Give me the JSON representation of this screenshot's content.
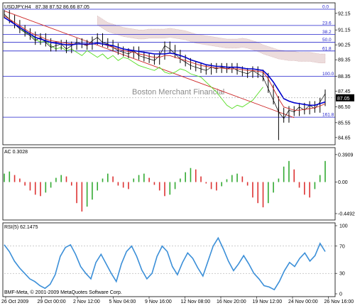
{
  "chart_data": {
    "type": "line",
    "main": {
      "title": "USDJPY,H4",
      "ohlc": "87.38 87.52 86.66 87.05",
      "watermark": "Boston Merchant Financial",
      "ylim": [
        84.3,
        92.7
      ],
      "y_ticks": [
        "92.15",
        "91.15",
        "90.25",
        "89.35",
        "88.35",
        "87.45",
        "86.50",
        "85.55",
        "84.65"
      ],
      "current_price": "87.05",
      "fibo_levels": [
        {
          "label": "0.0",
          "value": 92.4
        },
        {
          "label": "23.6",
          "value": 91.42
        },
        {
          "label": "38.2",
          "value": 90.88
        },
        {
          "label": "50.0",
          "value": 90.4
        },
        {
          "label": "61.8",
          "value": 89.88
        },
        {
          "label": "100.0",
          "value": 88.35
        },
        {
          "label": "161.8",
          "value": 85.88
        }
      ],
      "price_close": [
        92.1,
        91.8,
        91.5,
        91.2,
        91.0,
        90.8,
        90.5,
        90.7,
        90.4,
        90.1,
        90.2,
        90.3,
        90.0,
        90.2,
        90.4,
        90.3,
        90.2,
        90.5,
        90.7,
        90.4,
        90.3,
        90.1,
        89.9,
        89.8,
        89.7,
        89.9,
        89.6,
        89.5,
        89.4,
        89.3,
        89.6,
        90.2,
        90.0,
        89.7,
        89.4,
        89.2,
        89.0,
        88.9,
        88.8,
        88.7,
        88.9,
        88.8,
        88.9,
        88.8,
        88.9,
        88.7,
        88.6,
        88.5,
        88.7,
        88.5,
        88.3,
        87.6,
        86.9,
        86.2,
        85.8,
        86.3,
        86.2,
        86.5,
        86.3,
        86.6,
        86.4,
        86.8,
        87.3
      ],
      "ma_blue": [
        91.9,
        91.7,
        91.5,
        91.3,
        91.1,
        90.9,
        90.7,
        90.6,
        90.5,
        90.4,
        90.35,
        90.3,
        90.25,
        90.25,
        90.3,
        90.3,
        90.3,
        90.3,
        90.35,
        90.3,
        90.25,
        90.2,
        90.1,
        90.0,
        89.95,
        89.9,
        89.85,
        89.8,
        89.75,
        89.7,
        89.7,
        89.7,
        89.75,
        89.7,
        89.6,
        89.5,
        89.35,
        89.25,
        89.15,
        89.05,
        89.0,
        88.95,
        88.95,
        88.9,
        88.9,
        88.9,
        88.85,
        88.8,
        88.8,
        88.75,
        88.7,
        88.4,
        88.0,
        87.5,
        87.0,
        86.85,
        86.75,
        86.7,
        86.65,
        86.6,
        86.6,
        86.7,
        86.8
      ],
      "ma_red": [
        92.0,
        91.8,
        91.6,
        91.4,
        91.2,
        91.0,
        90.85,
        90.75,
        90.6,
        90.5,
        90.45,
        90.4,
        90.35,
        90.3,
        90.3,
        90.3,
        90.25,
        90.3,
        90.35,
        90.3,
        90.2,
        90.1,
        90.0,
        89.9,
        89.85,
        89.8,
        89.7,
        89.65,
        89.55,
        89.5,
        89.5,
        89.6,
        89.6,
        89.5,
        89.4,
        89.3,
        89.2,
        89.1,
        89.0,
        88.95,
        88.9,
        88.85,
        88.85,
        88.8,
        88.8,
        88.8,
        88.75,
        88.7,
        88.7,
        88.65,
        88.6,
        88.2,
        87.6,
        87.0,
        86.5,
        86.4,
        86.3,
        86.3,
        86.35,
        86.4,
        86.45,
        86.55,
        86.7
      ],
      "chikou_green": [
        91.3,
        91.0,
        90.9,
        90.6,
        90.4,
        90.5,
        90.2,
        90.0,
        90.1,
        89.9,
        90.0,
        89.8,
        89.6,
        89.9,
        89.7,
        89.5,
        89.7,
        89.4,
        89.6,
        89.3,
        89.5,
        89.4,
        89.2,
        89.0,
        88.9,
        88.8,
        88.7,
        88.9,
        88.6,
        88.5,
        88.6,
        88.8,
        88.7,
        88.5,
        88.4,
        88.3,
        88.0,
        87.7,
        87.4,
        87.0,
        86.6,
        86.4,
        86.6,
        86.5,
        86.7,
        86.9,
        87.3,
        87.7
      ]
    },
    "ac": {
      "title": "AC 0.3028",
      "y_ticks": [
        "0.3909",
        "0.00",
        "-0.4492"
      ],
      "ylim": [
        -0.5,
        0.45
      ],
      "values": [
        0.12,
        0.15,
        0.1,
        0.05,
        -0.05,
        -0.12,
        -0.18,
        -0.2,
        -0.15,
        -0.08,
        0.06,
        0.1,
        0.08,
        -0.05,
        -0.3,
        -0.42,
        -0.35,
        -0.25,
        -0.12,
        0.05,
        0.12,
        0.08,
        -0.05,
        -0.08,
        -0.1,
        0.05,
        0.1,
        0.12,
        0.06,
        -0.04,
        -0.12,
        -0.2,
        -0.18,
        -0.1,
        0.05,
        0.14,
        0.2,
        0.18,
        0.08,
        -0.02,
        -0.1,
        -0.12,
        -0.06,
        0.04,
        0.1,
        0.12,
        0.08,
        -0.05,
        -0.22,
        -0.3,
        -0.36,
        -0.3,
        -0.15,
        0.05,
        0.22,
        0.3,
        0.18,
        -0.08,
        -0.18,
        -0.22,
        -0.1,
        0.1,
        0.3
      ]
    },
    "rsi": {
      "title": "RSI(5) 62.1475",
      "y_ticks": [
        "100",
        "70",
        "30",
        "0"
      ],
      "ylim": [
        0,
        100
      ],
      "values": [
        72,
        62,
        48,
        38,
        30,
        22,
        18,
        12,
        8,
        14,
        28,
        55,
        68,
        72,
        58,
        40,
        30,
        22,
        46,
        58,
        44,
        30,
        18,
        44,
        62,
        70,
        55,
        35,
        22,
        30,
        55,
        70,
        62,
        40,
        28,
        46,
        60,
        52,
        38,
        26,
        48,
        70,
        82,
        66,
        48,
        34,
        44,
        56,
        44,
        30,
        22,
        12,
        10,
        6,
        18,
        34,
        46,
        40,
        52,
        60,
        48,
        56,
        74,
        62
      ]
    },
    "x_ticks": [
      "26 Oct 2009",
      "29 Oct 00:00",
      "2 Nov 12:00",
      "5 Nov 04:00",
      "9 Nov 16:00",
      "12 Nov 08:00",
      "16 Nov 20:00",
      "19 Nov 12:00",
      "24 Nov 00:00",
      "26 Nov 16:00"
    ],
    "copyright": "BMF-Meta, © 2001-2009 MetaQuotes Software Corp.",
    "colors": {
      "price": "#000000",
      "ma_blue": "#0000cc",
      "ma_red": "#cc2222",
      "chikou": "#55dd22",
      "cloud": "#c89a9a",
      "fibo": "#2222cc",
      "ac_up": "#33aa33",
      "ac_down": "#dd3333",
      "rsi": "#3b8fd8",
      "border": "#000000",
      "watermark": "#8a8a8a"
    }
  }
}
